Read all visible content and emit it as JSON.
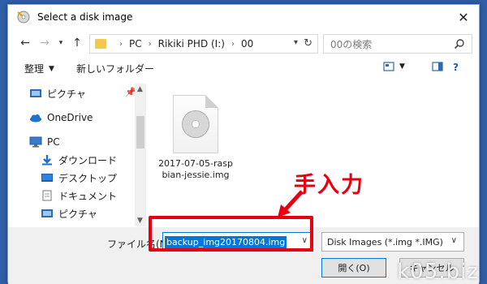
{
  "window": {
    "title": "Select a disk image"
  },
  "nav": {
    "breadcrumb": [
      "PC",
      "Rikiki PHD (I:)",
      "00"
    ],
    "search_placeholder": "00の検索"
  },
  "toolbar": {
    "organize": "整理",
    "new_folder": "新しいフォルダー"
  },
  "sidebar": {
    "items": [
      {
        "label": "ピクチャ",
        "icon": "pictures-icon"
      },
      {
        "label": "OneDrive",
        "icon": "cloud-icon"
      },
      {
        "label": "PC",
        "icon": "pc-icon"
      },
      {
        "label": "ダウンロード",
        "icon": "download-icon"
      },
      {
        "label": "デスクトップ",
        "icon": "desktop-icon"
      },
      {
        "label": "ドキュメント",
        "icon": "documents-icon"
      },
      {
        "label": "ピクチャ",
        "icon": "pictures-icon"
      }
    ]
  },
  "files": [
    {
      "name": "2017-07-05-raspbian-jessie.img",
      "icon": "disc-image-icon"
    }
  ],
  "footer": {
    "filename_label": "ファイル名(N):",
    "filename_value": "backup_img20170804.img",
    "filter_value": "Disk Images (*.img *.IMG)",
    "open_label": "開く(O)",
    "cancel_label": "キャンセル"
  },
  "annotation": {
    "text": "手入力"
  },
  "watermark": {
    "text": "k05.biz"
  },
  "colors": {
    "accent": "#0078d7",
    "annotation": "#e60012",
    "background": "#2f5fa8"
  }
}
